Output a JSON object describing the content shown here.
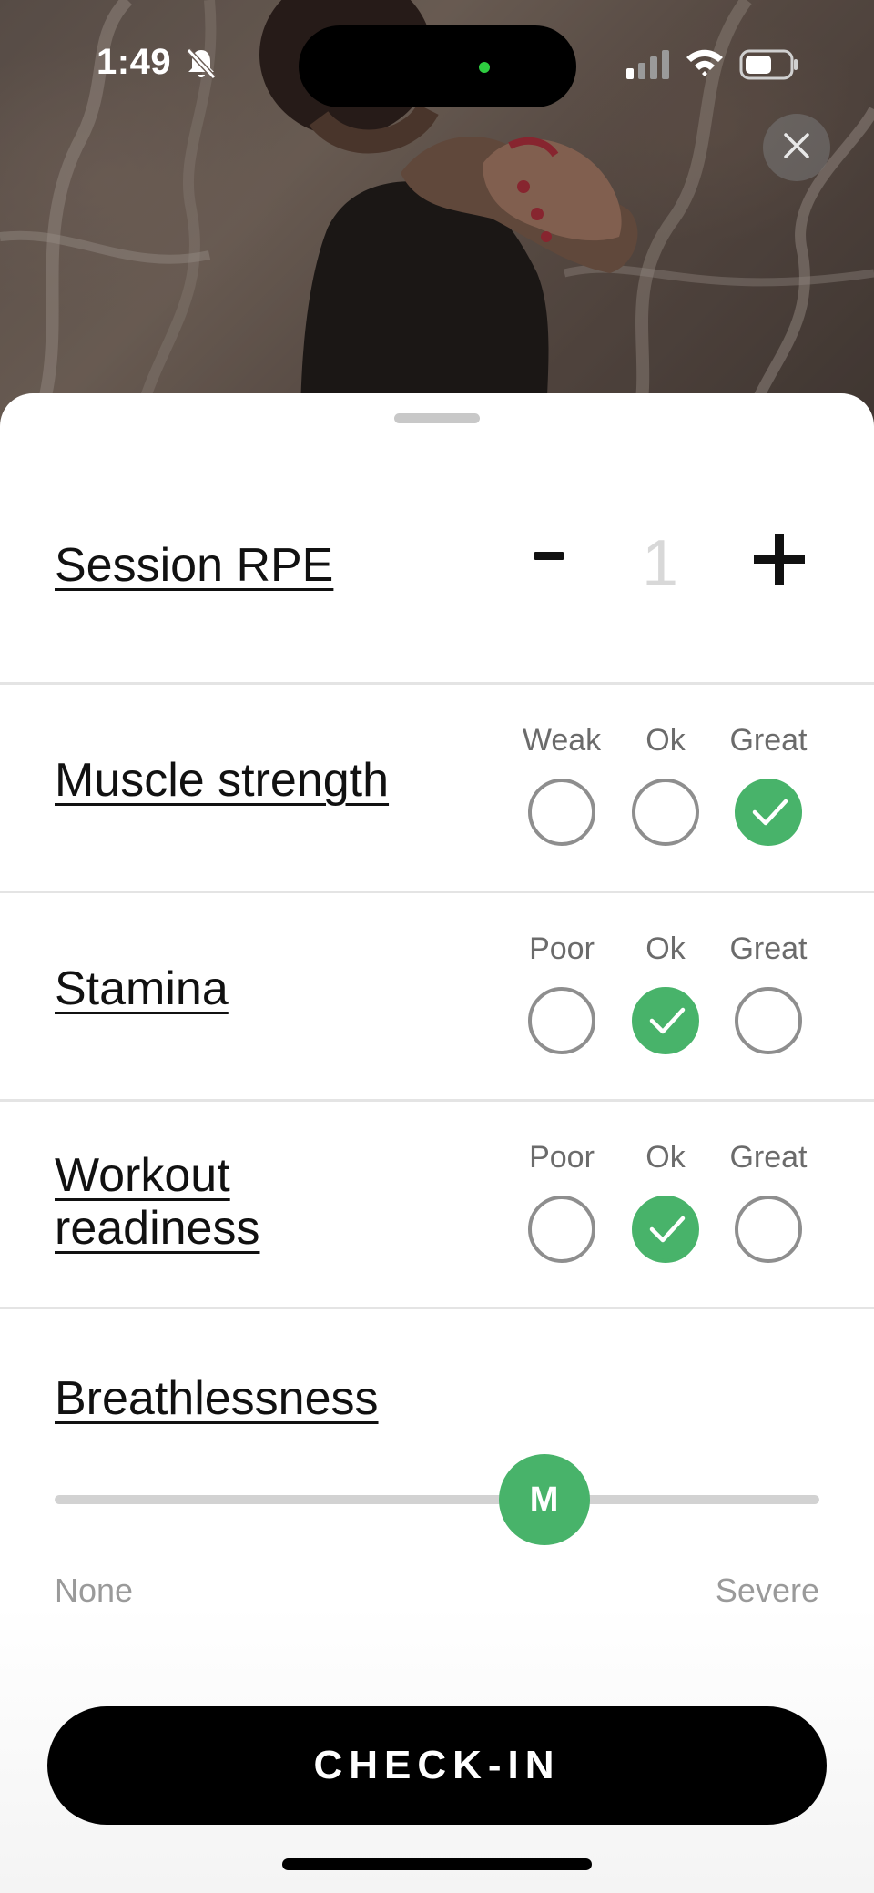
{
  "status_bar": {
    "time": "1:49",
    "icons": [
      "bell-slash-icon",
      "cellular-signal-icon",
      "wifi-icon",
      "battery-icon"
    ]
  },
  "header": {
    "close_icon": "close-icon"
  },
  "session_rpe": {
    "title": "Session RPE",
    "decrement_label": "-",
    "increment_label": "+",
    "value": "1"
  },
  "ratings": [
    {
      "title": "Muscle strength",
      "options": [
        "Weak",
        "Ok",
        "Great"
      ],
      "selected_index": 2
    },
    {
      "title": "Stamina",
      "options": [
        "Poor",
        "Ok",
        "Great"
      ],
      "selected_index": 1
    },
    {
      "title_lines": [
        "Workout",
        "readiness"
      ],
      "options": [
        "Poor",
        "Ok",
        "Great"
      ],
      "selected_index": 1
    }
  ],
  "breathlessness": {
    "title": "Breathlessness",
    "thumb_label": "M",
    "min_label": "None",
    "max_label": "Severe",
    "value_fraction": 0.64
  },
  "cta": {
    "label": "CHECK-IN"
  },
  "colors": {
    "accent_green": "#48b36a",
    "cta_background": "#000000",
    "rpe_value_color": "#d8d8d8"
  }
}
